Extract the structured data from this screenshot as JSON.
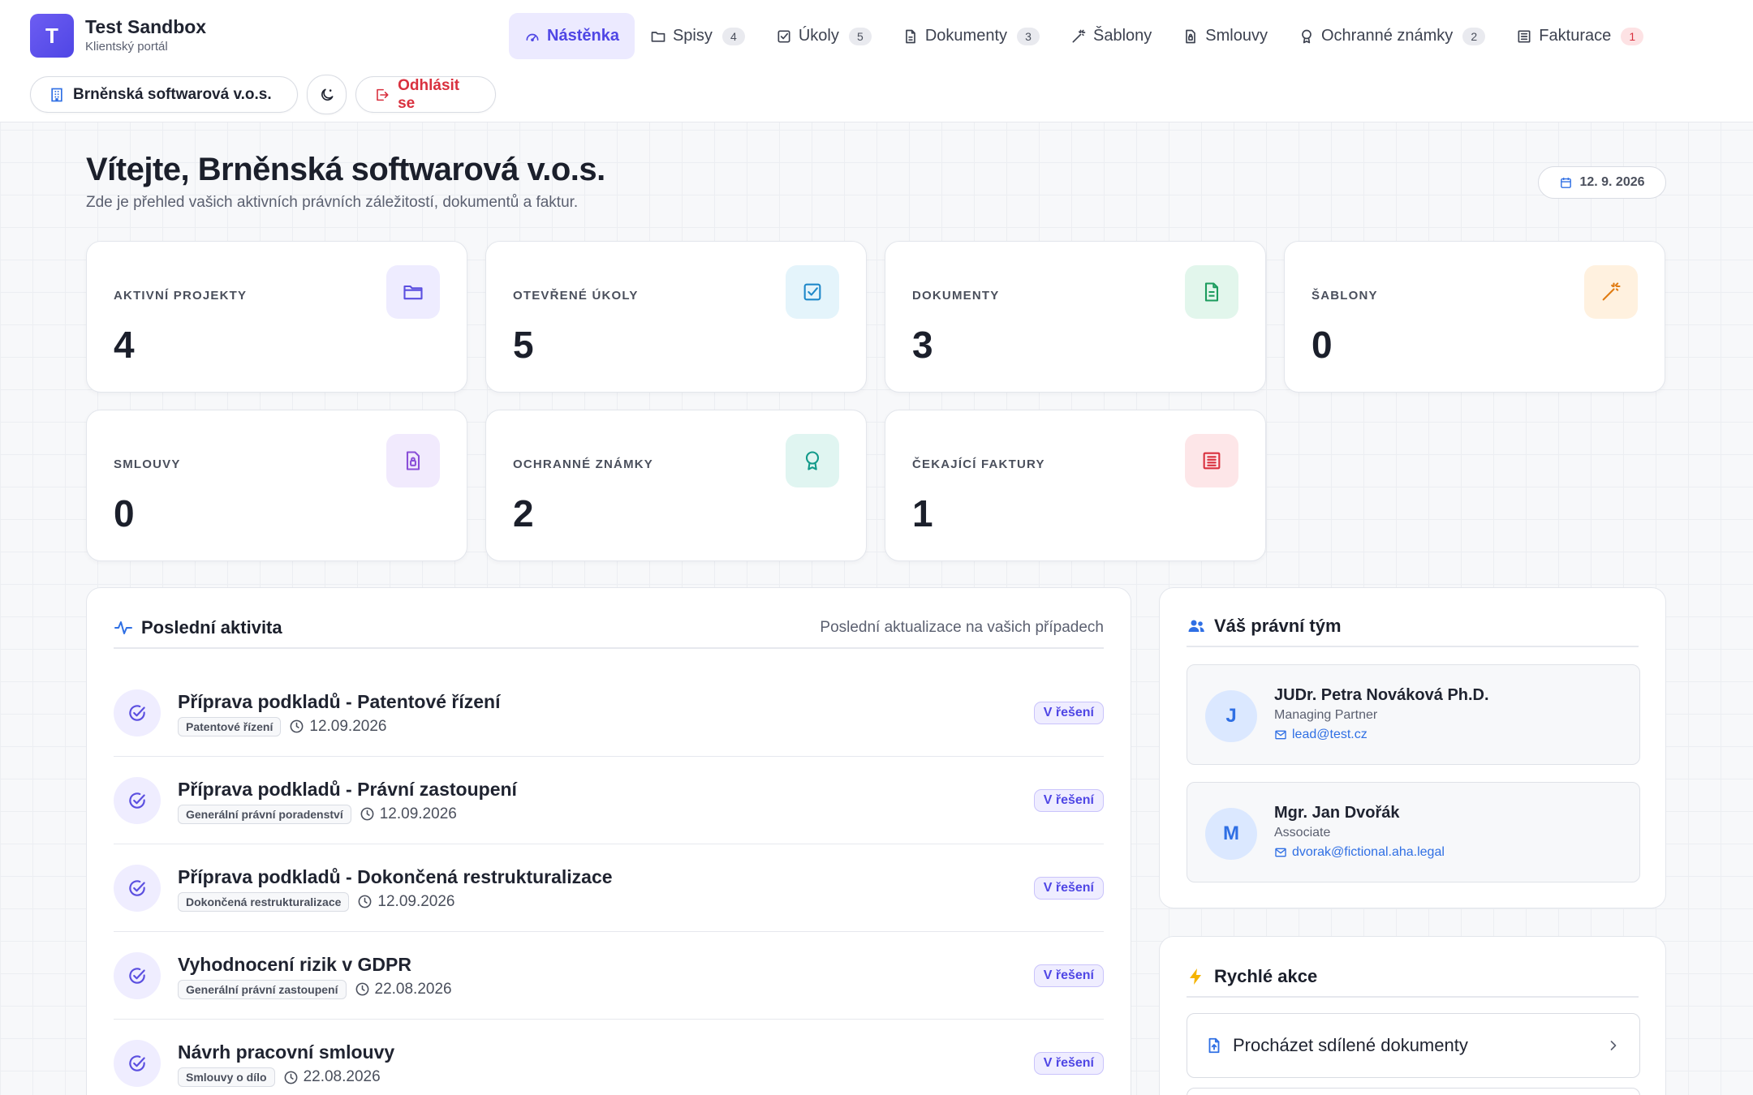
{
  "brand": {
    "logo_letter": "T",
    "title": "Test Sandbox",
    "subtitle": "Klientský portál"
  },
  "nav": [
    {
      "label": "Nástěnka",
      "active": true,
      "icon": "gauge-icon",
      "badge": ""
    },
    {
      "label": "Spisy",
      "active": false,
      "icon": "folder-icon",
      "badge": "4"
    },
    {
      "label": "Úkoly",
      "active": false,
      "icon": "checkbox-icon",
      "badge": "5"
    },
    {
      "label": "Dokumenty",
      "active": false,
      "icon": "document-icon",
      "badge": "3"
    },
    {
      "label": "Šablony",
      "active": false,
      "icon": "magic-wand-icon",
      "badge": ""
    },
    {
      "label": "Smlouvy",
      "active": false,
      "icon": "contract-icon",
      "badge": ""
    },
    {
      "label": "Ochranné známky",
      "active": false,
      "icon": "award-icon",
      "badge": "2"
    },
    {
      "label": "Fakturace",
      "active": false,
      "icon": "invoice-icon",
      "badge": "1"
    }
  ],
  "header": {
    "company_label": "Brněnská softwarová v.o.s.",
    "logout_label": "Odhlásit se"
  },
  "welcome": {
    "title": "Vítejte, Brněnská softwarová v.o.s.",
    "subtitle": "Zde je přehled vašich aktivních právních záležitostí, dokumentů a faktur.",
    "date": "12. 9. 2026"
  },
  "stats": [
    {
      "label": "AKTIVNÍ PROJEKTY",
      "value": "4",
      "icon": "folder-icon",
      "color": "#5b4fe0",
      "bg": "#eeecff"
    },
    {
      "label": "OTEVŘENÉ ÚKOLY",
      "value": "5",
      "icon": "checkbox-icon",
      "color": "#1e88c9",
      "bg": "#e4f4fb"
    },
    {
      "label": "DOKUMENTY",
      "value": "3",
      "icon": "document-icon",
      "color": "#1c9c5e",
      "bg": "#e2f6ec"
    },
    {
      "label": "ŠABLONY",
      "value": "0",
      "icon": "magic-wand-icon",
      "color": "#e07b12",
      "bg": "#fff1df"
    },
    {
      "label": "SMLOUVY",
      "value": "0",
      "icon": "contract-icon",
      "color": "#8a4fd8",
      "bg": "#f1eafd"
    },
    {
      "label": "OCHRANNÉ ZNÁMKY",
      "value": "2",
      "icon": "award-icon",
      "color": "#129a8a",
      "bg": "#e0f5f1"
    },
    {
      "label": "ČEKAJÍCÍ FAKTURY",
      "value": "1",
      "icon": "invoice-icon",
      "color": "#d9303e",
      "bg": "#fde6e8"
    }
  ],
  "activity": {
    "title": "Poslední aktivita",
    "subtitle": "Poslední aktualizace na vašich případech",
    "items": [
      {
        "title": "Příprava podkladů - Patentové řízení",
        "tag": "Patentové řízení",
        "date": "12.09.2026",
        "status": "V řešení"
      },
      {
        "title": "Příprava podkladů - Právní zastoupení",
        "tag": "Generální právní poradenství",
        "date": "12.09.2026",
        "status": "V řešení"
      },
      {
        "title": "Příprava podkladů - Dokončená restrukturalizace",
        "tag": "Dokončená restrukturalizace",
        "date": "12.09.2026",
        "status": "V řešení"
      },
      {
        "title": "Vyhodnocení rizik v GDPR",
        "tag": "Generální právní zastoupení",
        "date": "22.08.2026",
        "status": "V řešení"
      },
      {
        "title": "Návrh pracovní smlouvy",
        "tag": "Smlouvy o dílo",
        "date": "22.08.2026",
        "status": "V řešení"
      }
    ]
  },
  "team": {
    "title": "Váš právní tým",
    "members": [
      {
        "initial": "J",
        "name": "JUDr. Petra Nováková Ph.D.",
        "role": "Managing Partner",
        "email": "lead@test.cz"
      },
      {
        "initial": "M",
        "name": "Mgr. Jan Dvořák",
        "role": "Associate",
        "email": "dvorak@fictional.aha.legal"
      }
    ]
  },
  "quick": {
    "title": "Rychlé akce",
    "actions": [
      {
        "label": "Procházet sdílené dokumenty"
      }
    ]
  },
  "colors": {
    "accent": "#4f46e5",
    "danger": "#d9303e",
    "link": "#2f6fe4"
  }
}
